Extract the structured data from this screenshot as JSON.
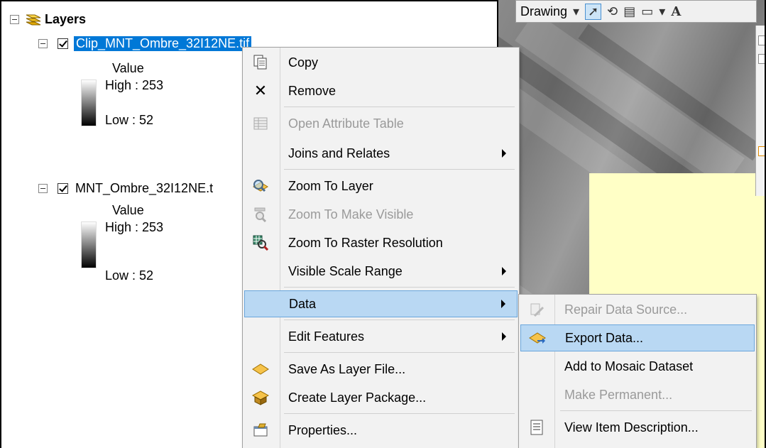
{
  "toc": {
    "root_label": "Layers",
    "layers": [
      {
        "name": "Clip_MNT_Ombre_32I12NE.tif",
        "checked": true,
        "selected": true,
        "legend_title": "Value",
        "high": "High : 253",
        "low": "Low : 52"
      },
      {
        "name": "MNT_Ombre_32I12NE.t",
        "checked": true,
        "selected": false,
        "legend_title": "Value",
        "high": "High : 253",
        "low": "Low : 52"
      }
    ]
  },
  "map": {
    "toolbar_label": "Drawing",
    "toolbar_letter": "A",
    "highlight_color": "#ffffc6"
  },
  "context_menu": {
    "items": [
      {
        "label": "Copy",
        "icon": "copy-icon",
        "enabled": true
      },
      {
        "label": "Remove",
        "icon": "remove-icon",
        "enabled": true
      },
      {
        "label": "Open Attribute Table",
        "icon": "table-icon",
        "enabled": false
      },
      {
        "label": "Joins and Relates",
        "icon": "",
        "enabled": true,
        "submenu": true
      },
      {
        "label": "Zoom To Layer",
        "icon": "zoom-layer-icon",
        "enabled": true
      },
      {
        "label": "Zoom To Make Visible",
        "icon": "zoom-visible-icon",
        "enabled": false
      },
      {
        "label": "Zoom To Raster Resolution",
        "icon": "zoom-raster-icon",
        "enabled": true
      },
      {
        "label": "Visible Scale Range",
        "icon": "",
        "enabled": true,
        "submenu": true
      },
      {
        "label": "Data",
        "icon": "",
        "enabled": true,
        "submenu": true,
        "hover": true
      },
      {
        "label": "Edit Features",
        "icon": "",
        "enabled": true,
        "submenu": true
      },
      {
        "label": "Save As Layer File...",
        "icon": "layer-file-icon",
        "enabled": true
      },
      {
        "label": "Create Layer Package...",
        "icon": "layer-package-icon",
        "enabled": true
      },
      {
        "label": "Properties...",
        "icon": "properties-icon",
        "enabled": true
      }
    ]
  },
  "data_submenu": {
    "items": [
      {
        "label": "Repair Data Source...",
        "icon": "repair-icon",
        "enabled": false
      },
      {
        "label": "Export Data...",
        "icon": "export-icon",
        "enabled": true,
        "hover": true
      },
      {
        "label": "Add to Mosaic Dataset",
        "icon": "",
        "enabled": true
      },
      {
        "label": "Make Permanent...",
        "icon": "",
        "enabled": false
      },
      {
        "label": "View Item Description...",
        "icon": "description-icon",
        "enabled": true
      }
    ]
  },
  "colors": {
    "selection": "#0078d7",
    "menu_hover": "#b9d8f3",
    "disabled_text": "#9a9a9a"
  }
}
